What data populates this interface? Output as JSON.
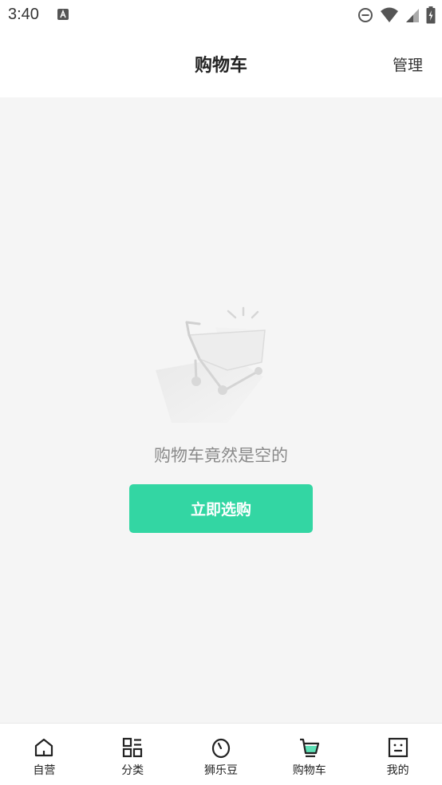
{
  "status_bar": {
    "time": "3:40",
    "icons": [
      "a-notification-icon",
      "do-not-disturb-icon",
      "wifi-icon",
      "signal-icon",
      "battery-icon"
    ]
  },
  "header": {
    "title": "购物车",
    "manage_label": "管理"
  },
  "empty_state": {
    "illustration": "empty-cart-illustration",
    "message": "购物车竟然是空的",
    "button_label": "立即选购"
  },
  "tabs": [
    {
      "label": "自营",
      "icon": "home-icon",
      "active": false
    },
    {
      "label": "分类",
      "icon": "category-icon",
      "active": false
    },
    {
      "label": "狮乐豆",
      "icon": "bean-icon",
      "active": false
    },
    {
      "label": "购物车",
      "icon": "cart-icon",
      "active": true
    },
    {
      "label": "我的",
      "icon": "profile-icon",
      "active": false
    }
  ],
  "colors": {
    "accent": "#33d6a3",
    "background": "#f5f5f5",
    "text_muted": "#8a8a8a"
  }
}
